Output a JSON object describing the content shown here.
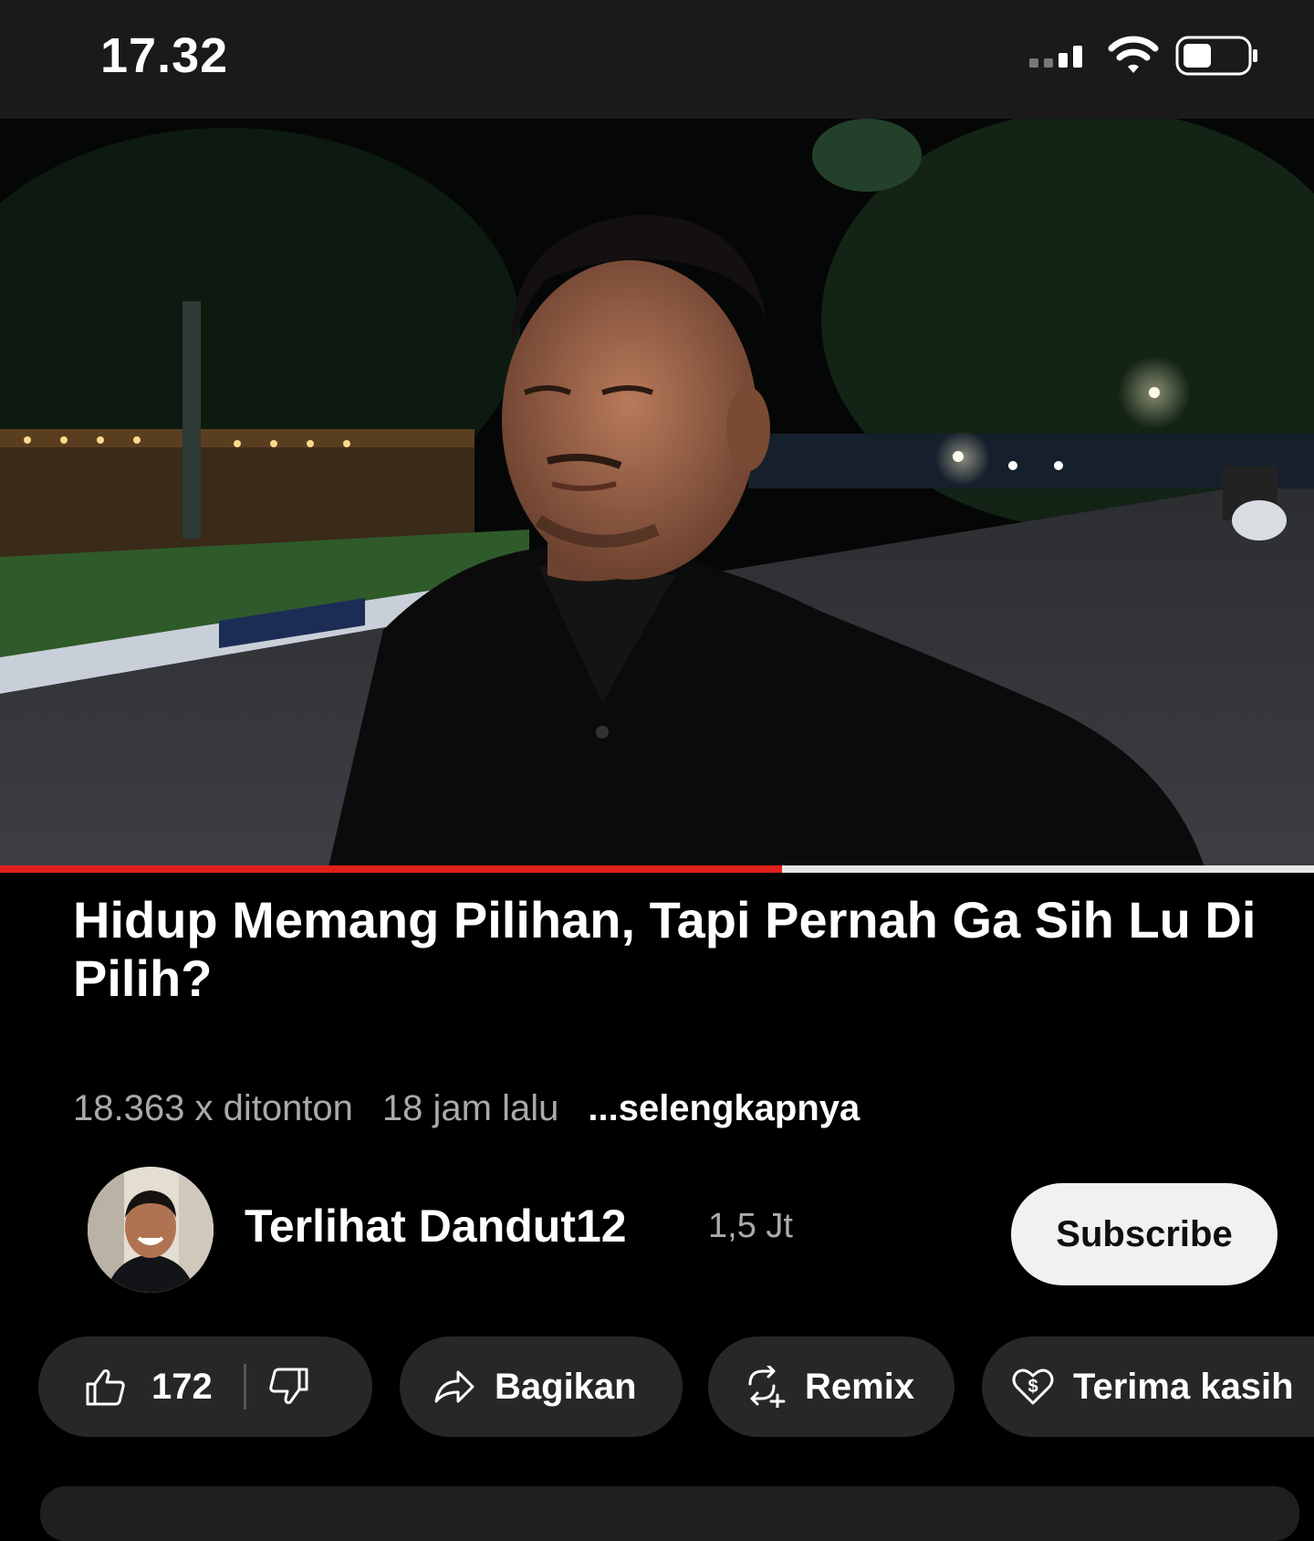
{
  "status_bar": {
    "time": "17.32"
  },
  "video": {
    "progress_fraction": 0.595,
    "title": "Hidup Memang Pilihan, Tapi Pernah Ga Sih Lu Di Pilih?"
  },
  "meta": {
    "views": "18.363 x ditonton",
    "age": "18 jam lalu",
    "more": "...selengkapnya"
  },
  "channel": {
    "name": "Terlihat Dandut12",
    "subscribers": "1,5 Jt",
    "subscribe_label": "Subscribe"
  },
  "actions": {
    "like_count": "172",
    "share_label": "Bagikan",
    "remix_label": "Remix",
    "thanks_label": "Terima kasih"
  },
  "colors": {
    "progress": "#e0201a",
    "chip_bg": "#272727",
    "subscribe_bg": "#f1f1f1"
  }
}
